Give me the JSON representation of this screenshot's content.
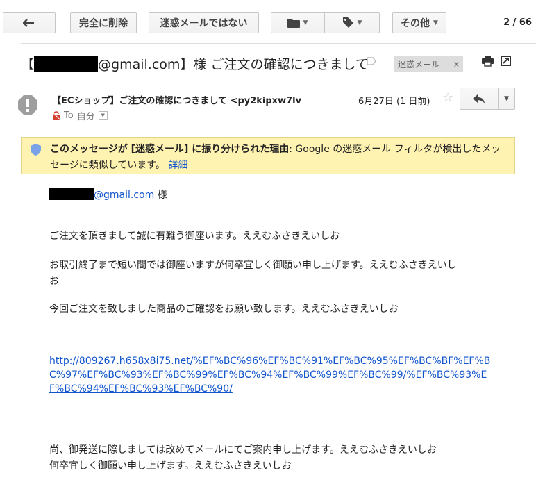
{
  "toolbar": {
    "delete_label": "完全に削除",
    "not_spam_label": "迷惑メールではない",
    "more_label": "その他",
    "pagination": "2 / 66"
  },
  "subject": {
    "prefix": "【",
    "email_suffix": "@gmail.com",
    "rest": "】様 ご注文の確認につきまして",
    "spam_chip": "迷惑メール",
    "spam_chip_close": "x"
  },
  "message": {
    "sender": "【ECショップ】ご注文の確認につきまして <py2kipxw7lv",
    "to_label": "To",
    "to_value": "自分",
    "date": "6月27日 (1 日前)"
  },
  "notice": {
    "bold": "このメッセージが [迷惑メール] に振り分けられた理由",
    "text": ": Google の迷惑メール フィルタが検出したメッセージに類似しています。",
    "details_link": "詳細"
  },
  "body": {
    "greeting_email": "@gmail.com",
    "greeting_suffix": " 様",
    "line1": "ご注文を頂きまして誠に有難う御座います。ええむふさきえいしお",
    "line2a": "お取引終了まで短い間では御座いますが何卒宜しく御願い申し上げます。ええむふさきえいし",
    "line2b": "お",
    "line3": "今回ご注文を致しました商品のご確認をお願い致します。ええむふさきえいしお",
    "url": "http://809267.h658x8i75.net/%EF%BC%96%EF%BC%91%EF%BC%95%EF%BC%BF%EF%BC%97%EF%BC%93%EF%BC%99%EF%BC%94%EF%BC%99%EF%BC%99/%EF%BC%93%EF%BC%94%EF%BC%93%EF%BC%90/",
    "line4": "尚、御発送に際しましては改めてメールにてご案内申し上げます。ええむふさきえいしお",
    "line5": "何卒宜しく御願い申し上げます。ええむふさきえいしお"
  },
  "icons": [
    "back-arrow-icon",
    "folder-icon",
    "tag-icon",
    "label-outline-icon",
    "print-icon",
    "new-window-icon",
    "warning-icon",
    "no-encryption-icon",
    "star-icon",
    "reply-icon",
    "shield-icon"
  ]
}
